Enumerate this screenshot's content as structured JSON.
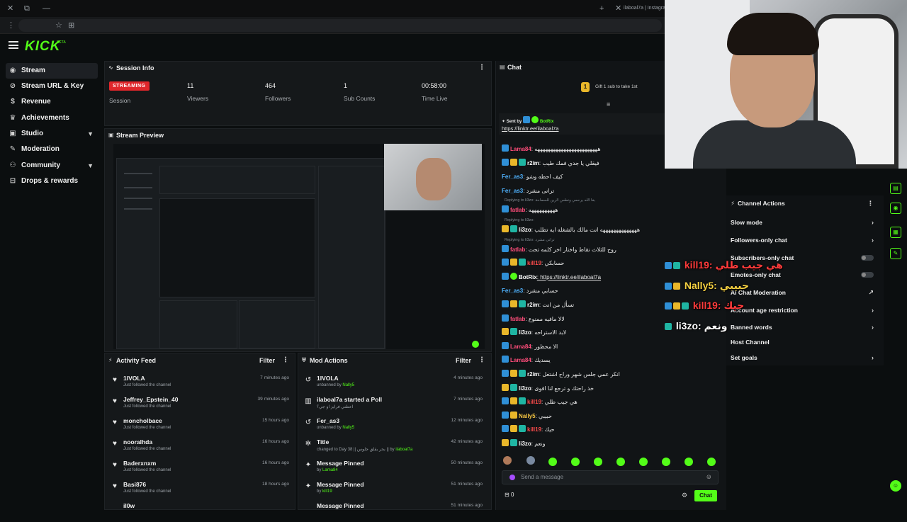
{
  "browser": {
    "tab_title": "ilaboal7a | Instagram"
  },
  "brand": {
    "logo": "KICK",
    "beta": "BETA"
  },
  "sidebar": {
    "items": [
      {
        "label": "Stream",
        "icon": "broadcast-icon"
      },
      {
        "label": "Stream URL & Key",
        "icon": "link-icon"
      },
      {
        "label": "Revenue",
        "icon": "dollar-icon"
      },
      {
        "label": "Achievements",
        "icon": "trophy-icon"
      },
      {
        "label": "Studio",
        "icon": "studio-icon"
      },
      {
        "label": "Moderation",
        "icon": "wrench-icon"
      },
      {
        "label": "Community",
        "icon": "people-icon"
      },
      {
        "label": "Drops & rewards",
        "icon": "gift-icon"
      }
    ]
  },
  "session": {
    "title": "Session Info",
    "badge": "STREAMING",
    "session_label": "Session",
    "stats": [
      {
        "value": "11",
        "label": "Viewers"
      },
      {
        "value": "464",
        "label": "Followers"
      },
      {
        "value": "1",
        "label": "Sub Counts"
      },
      {
        "value": "00:58:00",
        "label": "Time Live"
      }
    ]
  },
  "preview": {
    "title": "Stream Preview"
  },
  "activity": {
    "title": "Activity Feed",
    "filter": "Filter",
    "items": [
      {
        "name": "1IVOLA",
        "sub": "Just followed the channel",
        "time": "7 minutes ago"
      },
      {
        "name": "Jeffrey_Epstein_40",
        "sub": "Just followed the channel",
        "time": "39 minutes ago"
      },
      {
        "name": "moncholbace",
        "sub": "Just followed the channel",
        "time": "15 hours ago"
      },
      {
        "name": "nooralhda",
        "sub": "Just followed the channel",
        "time": "16 hours ago"
      },
      {
        "name": "Baderxnxm",
        "sub": "Just followed the channel",
        "time": "16 hours ago"
      },
      {
        "name": "Basi876",
        "sub": "Just followed the channel",
        "time": "18 hours ago"
      },
      {
        "name": "il0w",
        "sub": "",
        "time": ""
      }
    ]
  },
  "mod": {
    "title": "Mod Actions",
    "filter": "Filter",
    "items": [
      {
        "name": "1IVOLA",
        "sub": "unbanned by",
        "by": "Nally5",
        "time": "4 minutes ago"
      },
      {
        "name": "ilaboal7a started a Poll",
        "sub": "اعطني فرايز او جي؟",
        "by": "",
        "time": "7 minutes ago"
      },
      {
        "name": "Fer_as3",
        "sub": "unbanned by",
        "by": "Nally5",
        "time": "12 minutes ago"
      },
      {
        "name": "Title",
        "sub": "changed to Day 38 || بحر بقلق جلوس || by",
        "by": "ilaboal7a",
        "time": "42 minutes ago"
      },
      {
        "name": "Message Pinned",
        "sub": "by",
        "by": "Lama84",
        "time": "50 minutes ago"
      },
      {
        "name": "Message Pinned",
        "sub": "by",
        "by": "kill19",
        "time": "51 minutes ago"
      },
      {
        "name": "Message Pinned",
        "sub": "",
        "by": "",
        "time": "51 minutes ago"
      }
    ]
  },
  "chat": {
    "title": "Chat",
    "gift_banner": "Gift 1 sub to take 1st",
    "pinned_sent_by": "Sent by",
    "pinned_user": "BotRix",
    "pinned_link": "https://linktr.ee/ilaboal7a",
    "messages": [
      {
        "user": "Lama84",
        "color": "pink",
        "badges": [
          "blue"
        ],
        "text": ": ههههههههههههههههههههههههه"
      },
      {
        "user": "r2im",
        "color": "white",
        "badges": [
          "blue",
          "gold",
          "teal"
        ],
        "text": ": فيقلي يا جدي فمك طيب"
      },
      {
        "user": "Fer_as3",
        "color": "blue",
        "badges": [],
        "text": ": كيف احطه وشو"
      },
      {
        "user": "Fer_as3",
        "color": "blue",
        "badges": [],
        "text": ": ترانى مشرد"
      },
      {
        "reply": "Replying to li3zo: بغا الله يرحمي ونطس الرين للسماحة",
        "user": "fatlab",
        "color": "pink",
        "badges": [
          "blue"
        ],
        "text": ": ههههههههههه"
      },
      {
        "reply": "Replying to li3zo:",
        "user": "li3zo",
        "color": "white",
        "badges": [
          "gold",
          "teal"
        ],
        "text": ": ههههههههههههههه انت مالك بالشغله ايه تطلب"
      },
      {
        "reply": "Replying to li3zo: ترانى مشرد",
        "user": "fatlab",
        "color": "pink",
        "badges": [
          "blue"
        ],
        "text": ": روح للثلاث نقاط واختار اخر كلمه تحت"
      },
      {
        "user": "kill19",
        "color": "red",
        "badges": [
          "blue",
          "gold",
          "teal"
        ],
        "text": ": حسابكي"
      },
      {
        "user": "BotRix",
        "color": "white",
        "badges": [
          "blue",
          "green"
        ],
        "text": ": https://linktr.ee/ilaboal7a"
      },
      {
        "user": "Fer_as3",
        "color": "blue",
        "badges": [],
        "text": ": حسابي مشرد"
      },
      {
        "user": "r2im",
        "color": "white",
        "badges": [
          "blue",
          "gold",
          "teal"
        ],
        "text": ": تسأل من انت"
      },
      {
        "user": "fatlab",
        "color": "pink",
        "badges": [
          "blue"
        ],
        "text": ": لالا مافيه ممنوع"
      },
      {
        "user": "li3zo",
        "color": "white",
        "badges": [
          "gold",
          "teal"
        ],
        "text": ": لابد الاستراحه"
      },
      {
        "user": "Lama84",
        "color": "pink",
        "badges": [
          "blue"
        ],
        "text": ": الا محظور"
      },
      {
        "user": "Lama84",
        "color": "pink",
        "badges": [
          "blue"
        ],
        "text": ": يسديك"
      },
      {
        "user": "r2im",
        "color": "white",
        "badges": [
          "blue",
          "gold",
          "teal"
        ],
        "text": ": انكر عمي جلس شهر وراح اشتغل"
      },
      {
        "user": "li3zo",
        "color": "white",
        "badges": [
          "gold",
          "teal"
        ],
        "text": ": خذ راحتك و ترجع لنا اقوى"
      },
      {
        "user": "kill19",
        "color": "red",
        "badges": [
          "blue",
          "gold",
          "teal"
        ],
        "text": ": هي جيب طلي"
      },
      {
        "user": "Nally5",
        "color": "gold",
        "badges": [
          "blue",
          "gold"
        ],
        "text": ": حبيبي"
      },
      {
        "user": "kill19",
        "color": "red",
        "badges": [
          "blue",
          "gold",
          "teal"
        ],
        "text": ": حيك"
      },
      {
        "user": "li3zo",
        "color": "white",
        "badges": [
          "gold",
          "teal"
        ],
        "text": ": ونعم"
      }
    ],
    "input_placeholder": "Send a message",
    "count": "0",
    "send_label": "Chat"
  },
  "channel_actions": {
    "title": "Channel Actions",
    "items": [
      {
        "label": "Slow mode",
        "kind": "chevron"
      },
      {
        "label": "Followers-only chat",
        "kind": "chevron"
      },
      {
        "label": "Subscribers-only chat",
        "kind": "toggle"
      },
      {
        "label": "Emotes-only chat",
        "kind": "toggle"
      },
      {
        "label": "AI Chat Moderation",
        "kind": "external"
      },
      {
        "label": "Account age restriction",
        "kind": "chevron"
      },
      {
        "label": "Banned words",
        "kind": "chevron"
      },
      {
        "label": "Host Channel",
        "kind": "none"
      },
      {
        "label": "Set goals",
        "kind": "chevron"
      }
    ]
  },
  "overlay": {
    "lines": [
      {
        "user": "kill19",
        "text": ": هي جيب طلي",
        "color": "#ff3b3b"
      },
      {
        "user": "Nally5",
        "text": ": حبيبي",
        "color": "#f5d142"
      },
      {
        "user": "kill19",
        "text": ": حيك",
        "color": "#ff3b3b"
      },
      {
        "user": "li3zo",
        "text": ": ونعم",
        "color": "#ffffff"
      }
    ]
  },
  "colors": {
    "accent": "#53fc18",
    "live": "#e0262b",
    "panel": "#15181a"
  }
}
